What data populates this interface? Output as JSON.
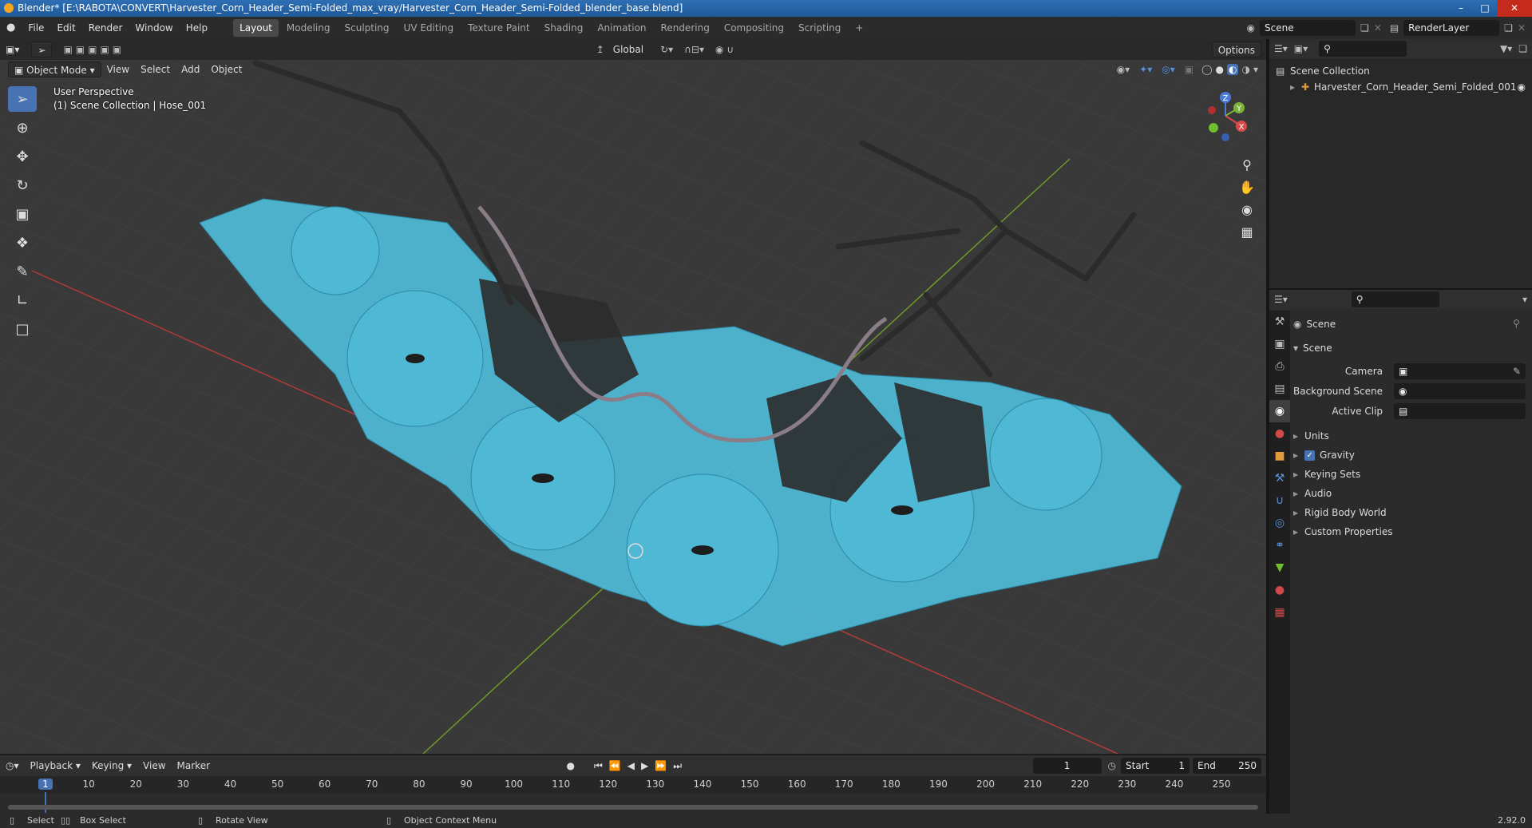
{
  "window": {
    "title": "Blender* [E:\\RABOTA\\CONVERT\\Harvester_Corn_Header_Semi-Folded_max_vray/Harvester_Corn_Header_Semi-Folded_blender_base.blend]"
  },
  "menu": [
    "File",
    "Edit",
    "Render",
    "Window",
    "Help"
  ],
  "workspaces": [
    "Layout",
    "Modeling",
    "Sculpting",
    "UV Editing",
    "Texture Paint",
    "Shading",
    "Animation",
    "Rendering",
    "Compositing",
    "Scripting"
  ],
  "active_workspace": "Layout",
  "scene_field": "Scene",
  "renderlayer_field": "RenderLayer",
  "viewport": {
    "transform_orientation": "Global",
    "options_label": "Options",
    "mode": "Object Mode",
    "header_menus": [
      "View",
      "Select",
      "Add",
      "Object"
    ],
    "overlay_line1": "User Perspective",
    "overlay_line2": "(1) Scene Collection | Hose_001",
    "gizmo": {
      "x": "X",
      "y": "Y",
      "z": "Z"
    }
  },
  "outliner": {
    "root": "Scene Collection",
    "items": [
      "Harvester_Corn_Header_Semi_Folded_001"
    ]
  },
  "properties": {
    "breadcrumb": "Scene",
    "panel": "Scene",
    "fields": [
      {
        "label": "Camera",
        "value": ""
      },
      {
        "label": "Background Scene",
        "value": ""
      },
      {
        "label": "Active Clip",
        "value": ""
      }
    ],
    "sections": [
      "Units",
      "Gravity",
      "Keying Sets",
      "Audio",
      "Rigid Body World",
      "Custom Properties"
    ],
    "gravity_checked": true
  },
  "timeline": {
    "menus": [
      "Playback",
      "Keying",
      "View",
      "Marker"
    ],
    "current_frame": "1",
    "start_label": "Start",
    "start": "1",
    "end_label": "End",
    "end": "250",
    "ticks": [
      "1",
      "10",
      "20",
      "30",
      "40",
      "50",
      "60",
      "70",
      "80",
      "90",
      "100",
      "110",
      "120",
      "130",
      "140",
      "150",
      "160",
      "170",
      "180",
      "190",
      "200",
      "210",
      "220",
      "230",
      "240",
      "250"
    ]
  },
  "status": {
    "select": "Select",
    "box_select": "Box Select",
    "rotate_view": "Rotate View",
    "context_menu": "Object Context Menu",
    "version": "2.92.0"
  },
  "colors": {
    "accent": "#4772b3",
    "mesh": "#4fb8d4",
    "dark": "#2a2a2a"
  }
}
